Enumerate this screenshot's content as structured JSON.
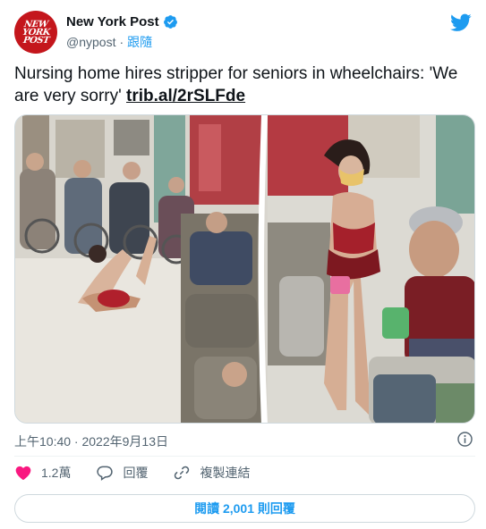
{
  "account": {
    "avatar_text": [
      "NEW",
      "YORK",
      "POST"
    ],
    "name": "New York Post",
    "handle": "@nypost",
    "separator": "·",
    "follow_label": "跟隨"
  },
  "tweet": {
    "text": "Nursing home hires stripper for seniors in wheelchairs: 'We are very sorry' ",
    "link_text": "trib.al/2rSLFde",
    "timestamp": "上午10:40 · 2022年9月13日"
  },
  "actions": {
    "likes": "1.2萬",
    "reply_label": "回覆",
    "copy_link_label": "複製連結"
  },
  "replies_button": "閱讀 2,001 則回覆",
  "colors": {
    "accent": "#1d9bf0",
    "like_red": "#f91880",
    "brand_red": "#c4161c"
  }
}
